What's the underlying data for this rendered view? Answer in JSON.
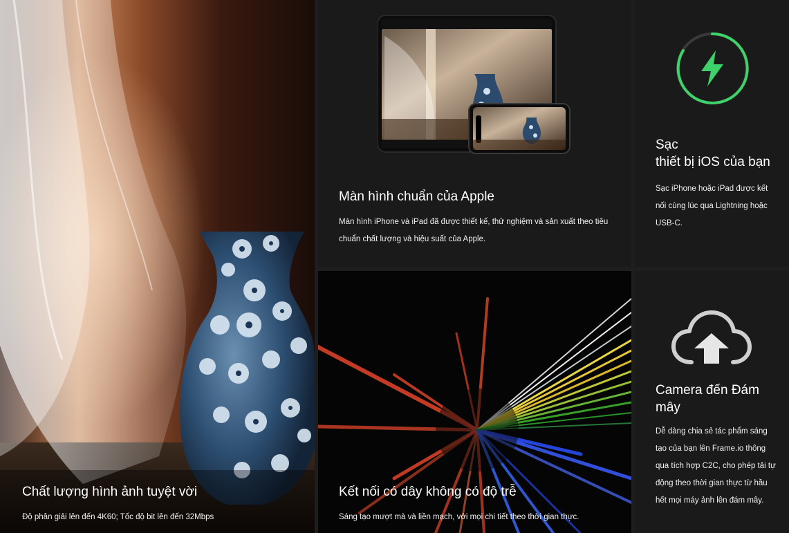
{
  "cards": {
    "image_quality": {
      "title": "Chất lượng hình ảnh tuyệt vời",
      "desc": "Độ phân giải lên đến 4K60; Tốc độ bit lên đến 32Mbps"
    },
    "apple_display": {
      "title": "Màn hình chuẩn của Apple",
      "desc": "Màn hình iPhone và iPad đã được thiết kế, thử nghiệm và sản xuất theo tiêu chuẩn chất lượng và hiệu suất của Apple."
    },
    "charging": {
      "title_line1": "Sạc",
      "title_line2": "thiết bị iOS của bạn",
      "desc": "Sạc iPhone hoặc iPad được kết nối cùng lúc qua Lightning hoặc USB-C."
    },
    "wired": {
      "title": "Kết nối có dây không có độ trễ",
      "desc": "Sáng tạo mượt mà và liền mạch, với mọi chi tiết theo thời gian thực."
    },
    "cloud": {
      "title": "Camera đến Đám mây",
      "desc": "Dễ dàng chia sẻ tác phẩm sáng tạo của bạn lên Frame.io thông qua tích hợp C2C, cho phép tải tự động theo thời gian thực từ hầu hết mọi máy ảnh lên đám mây."
    }
  },
  "icons": {
    "charge": "lightning-bolt-icon",
    "cloud": "cloud-upload-icon"
  },
  "colors": {
    "accent_green": "#3fd26a",
    "card_bg": "#1a1a1a",
    "page_bg": "#1e1e1e"
  }
}
